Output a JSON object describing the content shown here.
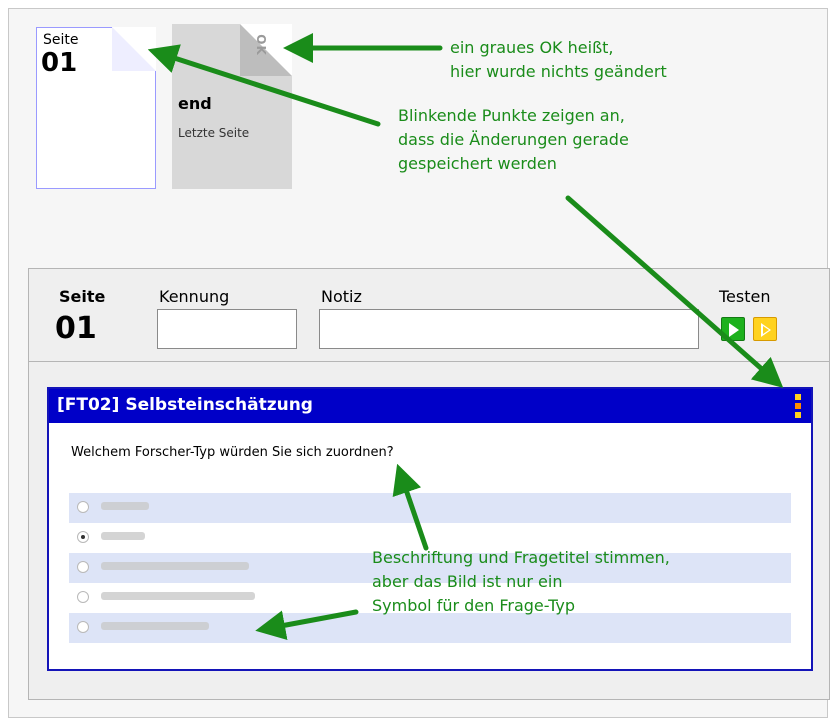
{
  "page_card": {
    "label": "Seite",
    "number": "01",
    "dot_colors": [
      "#ffd21f",
      "#ffd21f",
      "#ff8c00"
    ]
  },
  "end_card": {
    "ok": "OK",
    "title": "end",
    "subtitle": "Letzte Seite"
  },
  "annotations": {
    "grey_ok": "ein graues OK heißt,\nhier wurde nichts geändert",
    "blinking": "Blinkende Punkte zeigen an,\ndass die Änderungen gerade\ngespeichert werden",
    "caption": "Beschriftung und Fragetitel stimmen,\naber das Bild ist nur ein\nSymbol für den Frage-Typ"
  },
  "editor": {
    "seite_label": "Seite",
    "seite_number": "01",
    "kennung_label": "Kennung",
    "kennung_value": "",
    "notiz_label": "Notiz",
    "notiz_value": "",
    "testen_label": "Testen"
  },
  "question": {
    "title": "[FT02] Selbsteinschätzung",
    "text": "Welchem Forscher-Typ würden Sie sich zuordnen?",
    "options": [
      {
        "selected": false
      },
      {
        "selected": true
      },
      {
        "selected": false
      },
      {
        "selected": false
      },
      {
        "selected": false
      }
    ]
  },
  "colors": {
    "annotation": "#1a8c1a",
    "question_header": "#0000c8",
    "accent_orange": "#ff8c00",
    "accent_yellow": "#ffd21f",
    "test_green": "#1db11d"
  },
  "icons": {
    "test_button": "play-icon",
    "test_alt_button": "play-outline-icon"
  }
}
